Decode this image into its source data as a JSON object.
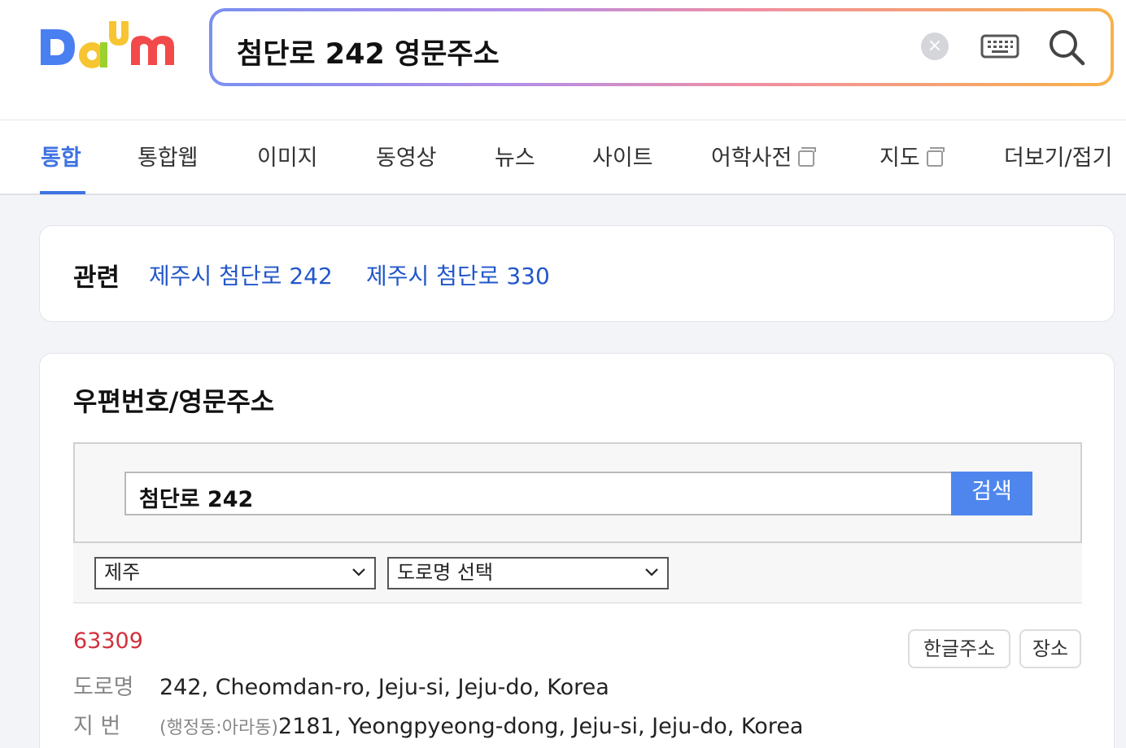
{
  "search": {
    "query": "첨단로 242 영문주소",
    "clear_symbol": "×"
  },
  "logo": {
    "text": "Daum",
    "colors": [
      "#4a7ff2",
      "#f7c531",
      "#9bd12e",
      "#f24a4a"
    ]
  },
  "tabs": [
    {
      "label": "통합",
      "active": true
    },
    {
      "label": "통합웹"
    },
    {
      "label": "이미지"
    },
    {
      "label": "동영상"
    },
    {
      "label": "뉴스"
    },
    {
      "label": "사이트"
    },
    {
      "label": "어학사전",
      "icon": "external-link-icon"
    },
    {
      "label": "지도",
      "icon": "external-link-icon"
    },
    {
      "label": "더보기/접기"
    }
  ],
  "related": {
    "label": "관련",
    "links": [
      "제주시 첨단로 242",
      "제주시 첨단로 330"
    ]
  },
  "zip": {
    "title": "우편번호/영문주소",
    "input_value": "첨단로 242",
    "search_label": "검색",
    "region_select": "제주",
    "road_select": "도로명 선택",
    "result": {
      "code": "63309",
      "road_label": "도로명",
      "road_value": "242, Cheomdan-ro, Jeju-si, Jeju-do, Korea",
      "lot_label": "지 번",
      "lot_prefix": "(행정동:아라동)",
      "lot_value": "2181, Yeongpyeong-dong, Jeju-si, Jeju-do, Korea",
      "btn_korean": "한글주소",
      "btn_place": "장소"
    }
  },
  "colors": {
    "accent": "#3f73e3",
    "link": "#2257c9",
    "zipcode": "#d0313d",
    "search_button": "#4e86ee"
  }
}
